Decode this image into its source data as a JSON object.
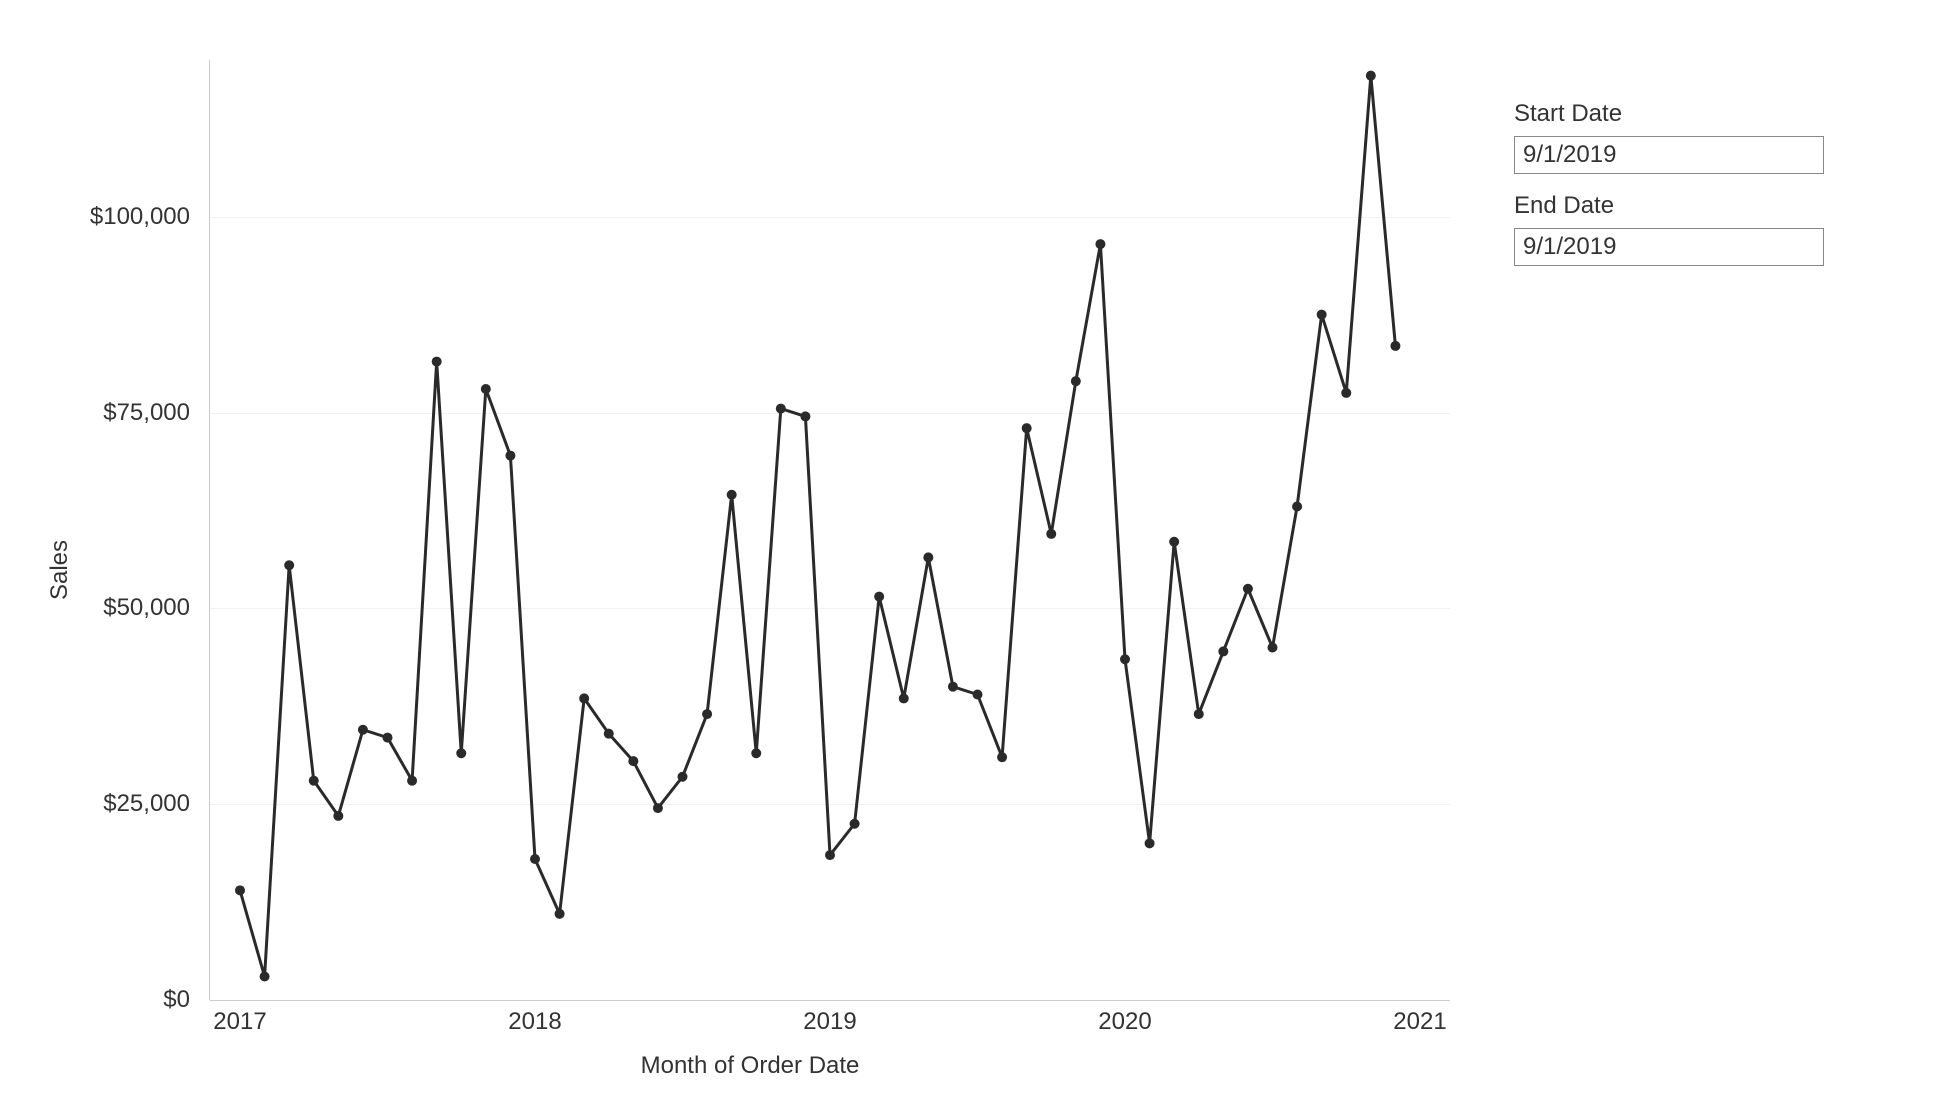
{
  "chart_data": {
    "type": "line",
    "ylabel": "Sales",
    "xlabel": "Month of Order Date",
    "ylim": [
      0,
      120000
    ],
    "y_ticks": [
      {
        "value": 0,
        "label": "$0"
      },
      {
        "value": 25000,
        "label": "$25,000"
      },
      {
        "value": 50000,
        "label": "$50,000"
      },
      {
        "value": 75000,
        "label": "$75,000"
      },
      {
        "value": 100000,
        "label": "$100,000"
      }
    ],
    "x_ticks": [
      {
        "x": 0,
        "label": "2017"
      },
      {
        "x": 12,
        "label": "2018"
      },
      {
        "x": 24,
        "label": "2019"
      },
      {
        "x": 36,
        "label": "2020"
      },
      {
        "x": 48,
        "label": "2021"
      }
    ],
    "xlim": [
      0,
      48
    ],
    "series": [
      {
        "name": "Sales",
        "values": [
          14000,
          3000,
          55500,
          28000,
          23500,
          34500,
          33500,
          28000,
          81500,
          31500,
          78000,
          69500,
          18000,
          11000,
          38500,
          34000,
          30500,
          24500,
          28500,
          36500,
          64500,
          31500,
          75500,
          74500,
          18500,
          22500,
          51500,
          38500,
          56500,
          40000,
          39000,
          31000,
          73000,
          59500,
          79000,
          96500,
          43500,
          20000,
          58500,
          36500,
          44500,
          52500,
          45000,
          63000,
          87500,
          77500,
          118000,
          83500
        ]
      }
    ]
  },
  "controls": {
    "start_label": "Start Date",
    "start_value": "9/1/2019",
    "end_label": "End Date",
    "end_value": "9/1/2019"
  }
}
